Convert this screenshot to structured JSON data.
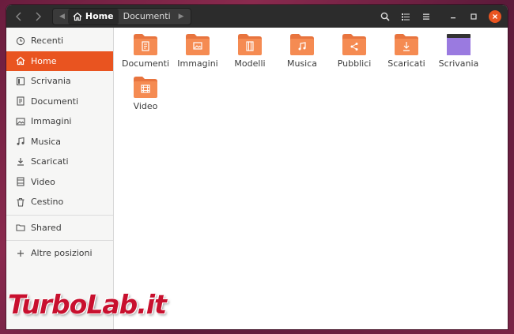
{
  "header": {
    "back_icon": "chevron-left-icon",
    "forward_icon": "chevron-right-icon",
    "path": [
      {
        "label": "Home",
        "icon": "home-icon",
        "active": true
      },
      {
        "label": "Documenti",
        "active": false
      }
    ],
    "actions": [
      "search-icon",
      "list-view-icon",
      "menu-icon"
    ],
    "window_controls": [
      "minimize-icon",
      "maximize-icon",
      "close-icon"
    ]
  },
  "sidebar": {
    "items": [
      {
        "label": "Recenti",
        "icon": "clock-icon",
        "active": false
      },
      {
        "label": "Home",
        "icon": "home-icon",
        "active": true
      },
      {
        "label": "Scrivania",
        "icon": "desktop-icon",
        "active": false
      },
      {
        "label": "Documenti",
        "icon": "document-icon",
        "active": false
      },
      {
        "label": "Immagini",
        "icon": "image-icon",
        "active": false
      },
      {
        "label": "Musica",
        "icon": "music-icon",
        "active": false
      },
      {
        "label": "Scaricati",
        "icon": "download-icon",
        "active": false
      },
      {
        "label": "Video",
        "icon": "video-icon",
        "active": false
      },
      {
        "label": "Cestino",
        "icon": "trash-icon",
        "active": false
      }
    ],
    "shared": {
      "label": "Shared",
      "icon": "folder-shared-icon"
    },
    "other": {
      "label": "Altre posizioni",
      "icon": "plus-icon"
    }
  },
  "files": [
    {
      "name": "Documenti",
      "type": "documents"
    },
    {
      "name": "Immagini",
      "type": "pictures"
    },
    {
      "name": "Modelli",
      "type": "templates"
    },
    {
      "name": "Musica",
      "type": "music"
    },
    {
      "name": "Pubblici",
      "type": "public"
    },
    {
      "name": "Scaricati",
      "type": "downloads"
    },
    {
      "name": "Scrivania",
      "type": "desktop"
    },
    {
      "name": "Video",
      "type": "videos"
    }
  ],
  "watermark": "TurboLab.it",
  "colors": {
    "accent": "#e95420",
    "header": "#2c2c2c",
    "sidebar": "#f6f6f5",
    "folder": "#f58b52",
    "desktop_folder": "#8f6dd6"
  }
}
